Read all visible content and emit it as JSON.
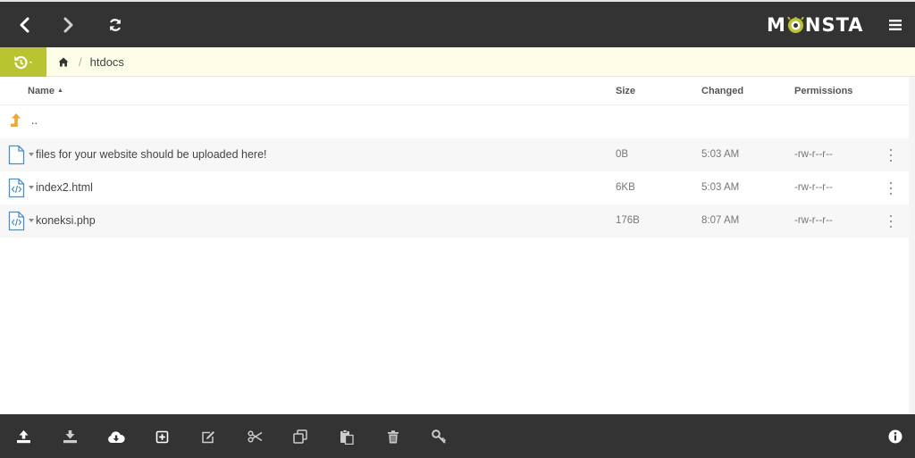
{
  "topbar": {
    "back_icon": "chevron-left-icon",
    "forward_icon": "chevron-right-icon",
    "refresh_icon": "refresh-icon",
    "logo_text_left": "M",
    "logo_text_right": "NSTA",
    "menu_icon": "hamburger-menu-icon"
  },
  "breadcrumb": {
    "history_icon": "history-icon",
    "home_icon": "home-icon",
    "separator": "/",
    "current": "htdocs"
  },
  "columns": {
    "name": "Name",
    "sort_indicator": "▲",
    "size": "Size",
    "changed": "Changed",
    "permissions": "Permissions"
  },
  "parent_row": {
    "label": "..",
    "icon": "parent-directory-arrow-icon"
  },
  "files": [
    {
      "name": "files for your website should be uploaded here!",
      "icon": "file-icon",
      "size": "0B",
      "changed": "5:03 AM",
      "permissions": "-rw-r--r--"
    },
    {
      "name": "index2.html",
      "icon": "code-file-icon",
      "size": "6KB",
      "changed": "5:03 AM",
      "permissions": "-rw-r--r--"
    },
    {
      "name": "koneksi.php",
      "icon": "code-file-icon",
      "size": "176B",
      "changed": "8:07 AM",
      "permissions": "-rw-r--r--"
    }
  ],
  "toolbar": [
    "upload-icon",
    "download-icon",
    "cloud-download-icon",
    "new-item-icon",
    "edit-icon",
    "cut-icon",
    "copy-icon",
    "paste-icon",
    "delete-icon",
    "key-icon",
    "info-icon"
  ],
  "colors": {
    "topbar_bg": "#333333",
    "accent_green": "#b9c530",
    "breadcrumb_bg": "#fdfde8",
    "file_icon_blue": "#4a90c8",
    "folder_arrow_orange": "#f0a830"
  }
}
